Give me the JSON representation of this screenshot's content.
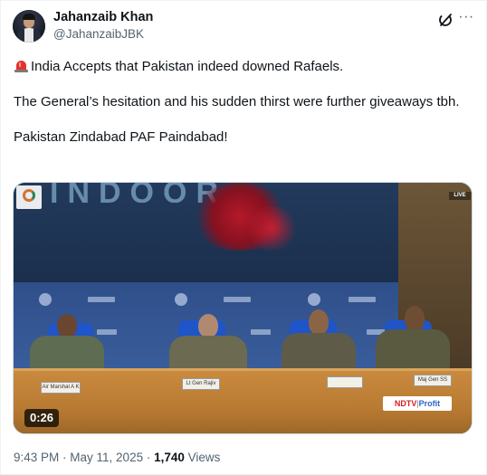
{
  "author": {
    "name": "Jahanzaib Khan",
    "handle": "@JahanzaibJBK"
  },
  "header_icons": [
    "grok-icon",
    "more-icon"
  ],
  "more_glyph": "···",
  "post": {
    "line1_icon": "siren-icon",
    "line1": "India Accepts that Pakistan indeed downed Rafaels.",
    "line2": "The General’s hesitation and his sudden thirst were further giveaways tbh.",
    "line3": "Pakistan Zindabad PAF Paindabad!"
  },
  "media": {
    "type": "video",
    "duration": "0:26",
    "banner_text": "INDOOR",
    "corner_tag": "LIVE",
    "broadcaster": "NDTV",
    "broadcaster_suffix": "Profit",
    "broadcaster_sep": "|",
    "nameplates": [
      "Air Marshal A K Bharti",
      "Lt Gen Rajiv Ghai",
      "",
      "Maj Gen SS Sharda"
    ]
  },
  "meta": {
    "time": "9:43 PM",
    "sep1": " · ",
    "date": "May 11, 2025",
    "sep2": " · ",
    "views_count": "1,740",
    "views_label": " Views"
  },
  "colors": {
    "text_primary": "#0f1419",
    "text_secondary": "#536471",
    "siren_red": "#e2342d"
  }
}
